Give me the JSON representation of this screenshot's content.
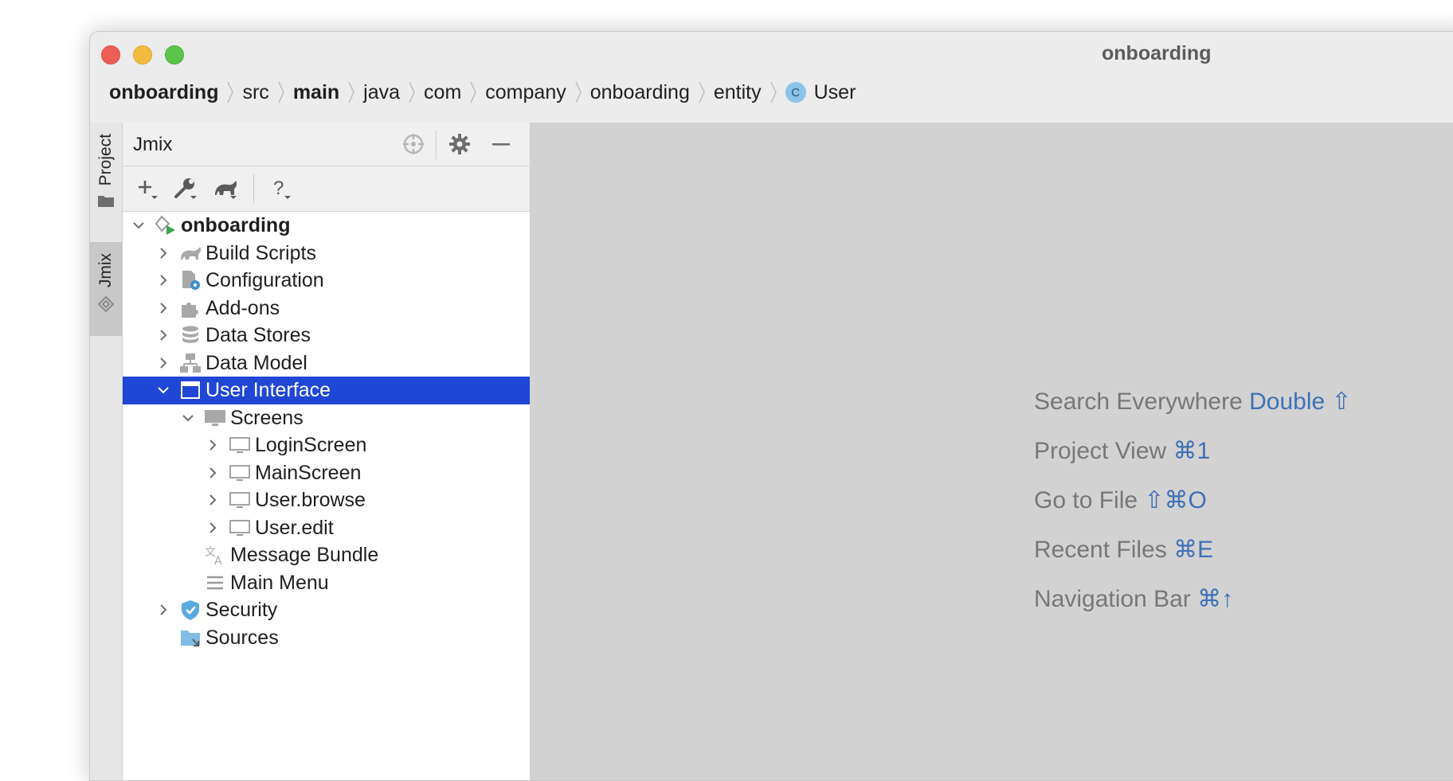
{
  "window": {
    "title": "onboarding"
  },
  "breadcrumb": [
    {
      "text": "onboarding",
      "bold": true
    },
    {
      "text": "src",
      "bold": false
    },
    {
      "text": "main",
      "bold": true
    },
    {
      "text": "java",
      "bold": false
    },
    {
      "text": "com",
      "bold": false
    },
    {
      "text": "company",
      "bold": false
    },
    {
      "text": "onboarding",
      "bold": false
    },
    {
      "text": "entity",
      "bold": false
    },
    {
      "text": "User",
      "bold": false,
      "badge": "C"
    }
  ],
  "side_tabs": {
    "project": "Project",
    "jmix": "Jmix"
  },
  "panel": {
    "title": "Jmix"
  },
  "tree": [
    {
      "label": "onboarding",
      "bold": true,
      "depth": 0,
      "expanded": true,
      "icon": "jmix-project-icon"
    },
    {
      "label": "Build Scripts",
      "depth": 1,
      "expanded": false,
      "icon": "gradle-icon"
    },
    {
      "label": "Configuration",
      "depth": 1,
      "expanded": false,
      "icon": "config-file-icon"
    },
    {
      "label": "Add-ons",
      "depth": 1,
      "expanded": false,
      "icon": "puzzle-icon"
    },
    {
      "label": "Data Stores",
      "depth": 1,
      "expanded": false,
      "icon": "database-icon"
    },
    {
      "label": "Data Model",
      "depth": 1,
      "expanded": false,
      "icon": "hierarchy-icon"
    },
    {
      "label": "User Interface",
      "depth": 1,
      "expanded": true,
      "selected": true,
      "icon": "window-icon"
    },
    {
      "label": "Screens",
      "depth": 2,
      "expanded": true,
      "icon": "monitor-filled-icon"
    },
    {
      "label": "LoginScreen",
      "depth": 3,
      "expanded": false,
      "icon": "monitor-icon"
    },
    {
      "label": "MainScreen",
      "depth": 3,
      "expanded": false,
      "icon": "monitor-icon"
    },
    {
      "label": "User.browse",
      "depth": 3,
      "expanded": false,
      "icon": "monitor-icon"
    },
    {
      "label": "User.edit",
      "depth": 3,
      "expanded": false,
      "icon": "monitor-icon"
    },
    {
      "label": "Message Bundle",
      "depth": 2,
      "icon": "translate-icon"
    },
    {
      "label": "Main Menu",
      "depth": 2,
      "icon": "menu-lines-icon"
    },
    {
      "label": "Security",
      "depth": 1,
      "expanded": false,
      "icon": "shield-icon"
    },
    {
      "label": "Sources",
      "depth": 1,
      "icon": "source-folder-icon"
    }
  ],
  "hints": [
    {
      "label": "Search Everywhere",
      "key": "Double ⇧"
    },
    {
      "label": "Project View",
      "key": "⌘1"
    },
    {
      "label": "Go to File",
      "key": "⇧⌘O"
    },
    {
      "label": "Recent Files",
      "key": "⌘E"
    },
    {
      "label": "Navigation Bar",
      "key": "⌘↑"
    }
  ],
  "colors": {
    "selection": "#2046d6",
    "hint_key": "#3e70b7",
    "editor_bg": "#d2d2d2"
  }
}
